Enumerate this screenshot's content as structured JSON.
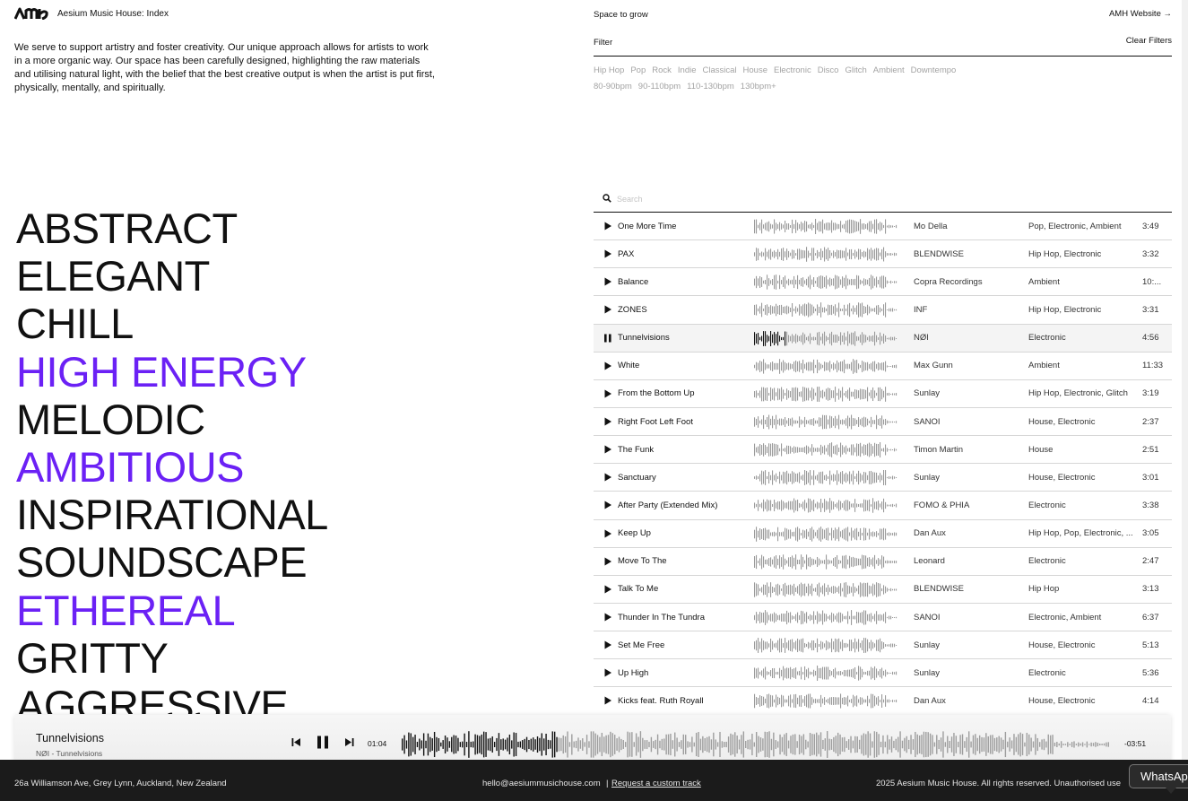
{
  "header": {
    "brand": "Aesium Music House: Index",
    "tagline": "Space to grow",
    "site_link": "AMH Website →"
  },
  "intro": "We serve to support artistry and foster creativity. Our unique approach allows for artists to work in a more organic way. Our space has been carefully designed, highlighting the raw materials and utilising natural light, with the belief that the best creative output is when the artist is put first, physically, mentally, and spiritually.",
  "filter": {
    "label": "Filter",
    "clear_label": "Clear Filters",
    "genres": [
      "Hip Hop",
      "Pop",
      "Rock",
      "Indie",
      "Classical",
      "House",
      "Electronic",
      "Disco",
      "Glitch",
      "Ambient",
      "Downtempo"
    ],
    "bpms": [
      "80-90bpm",
      "90-110bpm",
      "110-130bpm",
      "130bpm+"
    ]
  },
  "moods": [
    {
      "label": "ABSTRACT",
      "highlight": false
    },
    {
      "label": "ELEGANT",
      "highlight": false
    },
    {
      "label": "CHILL",
      "highlight": false
    },
    {
      "label": "HIGH ENERGY",
      "highlight": true
    },
    {
      "label": "MELODIC",
      "highlight": false
    },
    {
      "label": "AMBITIOUS",
      "highlight": true
    },
    {
      "label": "INSPIRATIONAL",
      "highlight": false
    },
    {
      "label": "SOUNDSCAPE",
      "highlight": false
    },
    {
      "label": "ETHEREAL",
      "highlight": true
    },
    {
      "label": "GRITTY",
      "highlight": false
    },
    {
      "label": "AGGRESSIVE",
      "highlight": false
    }
  ],
  "search": {
    "placeholder": "Search"
  },
  "tracks": [
    {
      "title": "One More Time",
      "artist": "Mo Della",
      "genres": "Pop, Electronic, Ambient",
      "duration": "3:49"
    },
    {
      "title": "PAX",
      "artist": "BLENDWISE",
      "genres": "Hip Hop, Electronic",
      "duration": "3:32"
    },
    {
      "title": "Balance",
      "artist": "Copra Recordings",
      "genres": "Ambient",
      "duration": "10:..."
    },
    {
      "title": "ZONES",
      "artist": "INF",
      "genres": "Hip Hop, Electronic",
      "duration": "3:31"
    },
    {
      "title": "Tunnelvisions",
      "artist": "NØI",
      "genres": "Electronic",
      "duration": "4:56",
      "playing": true,
      "progress": 0.22
    },
    {
      "title": "White",
      "artist": "Max Gunn",
      "genres": "Ambient",
      "duration": "11:33"
    },
    {
      "title": "From the Bottom Up",
      "artist": "Sunlay",
      "genres": "Hip Hop, Electronic, Glitch",
      "duration": "3:19"
    },
    {
      "title": "Right Foot Left Foot",
      "artist": "SANOI",
      "genres": "House, Electronic",
      "duration": "2:37"
    },
    {
      "title": "The Funk",
      "artist": "Timon Martin",
      "genres": "House",
      "duration": "2:51"
    },
    {
      "title": "Sanctuary",
      "artist": "Sunlay",
      "genres": "House, Electronic",
      "duration": "3:01"
    },
    {
      "title": "After Party (Extended Mix)",
      "artist": "FOMO & PHIA",
      "genres": "Electronic",
      "duration": "3:38"
    },
    {
      "title": "Keep Up",
      "artist": "Dan Aux",
      "genres": "Hip Hop, Pop, Electronic, ...",
      "duration": "3:05"
    },
    {
      "title": "Move To The",
      "artist": "Leonard",
      "genres": "Electronic",
      "duration": "2:47"
    },
    {
      "title": "Talk To Me",
      "artist": "BLENDWISE",
      "genres": "Hip Hop",
      "duration": "3:13"
    },
    {
      "title": "Thunder In The Tundra",
      "artist": "SANOI",
      "genres": "Electronic, Ambient",
      "duration": "6:37"
    },
    {
      "title": "Set Me Free",
      "artist": "Sunlay",
      "genres": "House, Electronic",
      "duration": "5:13"
    },
    {
      "title": "Up High",
      "artist": "Sunlay",
      "genres": "Electronic",
      "duration": "5:36"
    },
    {
      "title": "Kicks feat. Ruth Royall",
      "artist": "Dan Aux",
      "genres": "House, Electronic",
      "duration": "4:14"
    }
  ],
  "player": {
    "title": "Tunnelvisions",
    "subtitle": "NØI - Tunnelvisions",
    "current_time": "01:04",
    "remaining_time": "-03:51",
    "progress": 0.22
  },
  "footer": {
    "address": "26a Williamson Ave, Grey Lynn, Auckland, New Zealand",
    "email": "hello@aesiummusichouse.com",
    "separator": "|",
    "request_link": "Request a custom track",
    "copyright": "2025 Aesium Music House. All rights reserved. Unauthorised use"
  },
  "whatsapp_label": "WhatsApp",
  "colors": {
    "accent": "#6b21f5",
    "text": "#111111",
    "muted": "#a3a3a3",
    "footer_bg": "#1b1b1b"
  },
  "icons": {
    "play": "play-icon",
    "pause": "pause-icon",
    "search": "search-icon",
    "prev": "skip-back-icon",
    "next": "skip-forward-icon"
  }
}
